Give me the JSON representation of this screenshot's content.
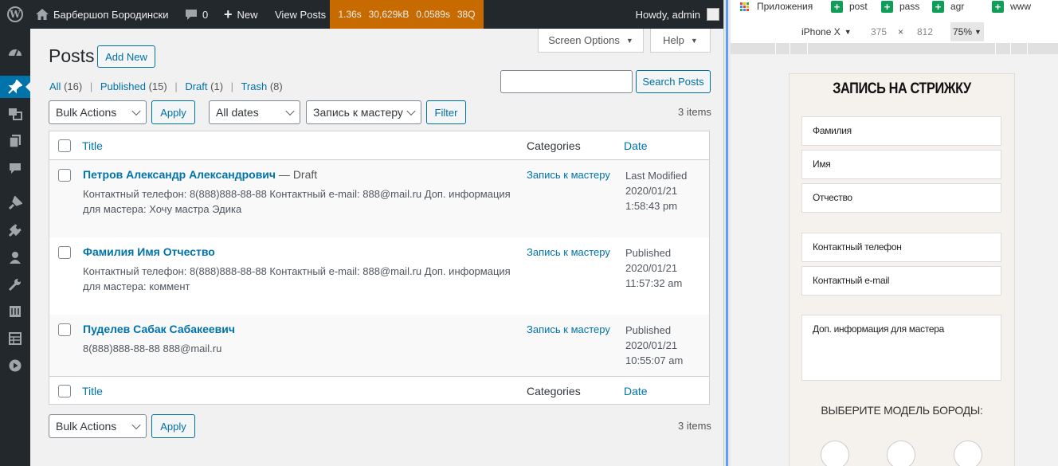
{
  "adminbar": {
    "wp_logo": "W",
    "site_name": "Барбершоп Бородински",
    "comments_count": "0",
    "new_label": "New",
    "view_posts_label": "View Posts",
    "qm": {
      "time": "1.36s",
      "memory": "30,629kB",
      "db_time": "0.0589s",
      "queries": "38Q"
    },
    "howdy": "Howdy, admin"
  },
  "sidebar": {
    "icons": [
      "dashboard-icon",
      "posts-icon",
      "media-icon",
      "pages-icon",
      "comments-icon",
      "appearance-icon",
      "plugins-icon",
      "users-icon",
      "tools-icon",
      "settings-icon",
      "table-icon",
      "play-icon"
    ],
    "active": "posts-icon"
  },
  "screen_options": {
    "screen_options_label": "Screen Options",
    "help_label": "Help"
  },
  "posts": {
    "title": "Posts",
    "add_new_label": "Add New",
    "views": [
      {
        "label": "All",
        "count": "(16)"
      },
      {
        "label": "Published",
        "count": "(15)"
      },
      {
        "label": "Draft",
        "count": "(1)"
      },
      {
        "label": "Trash",
        "count": "(8)"
      }
    ],
    "search_button": "Search Posts",
    "search_value": "",
    "bulk_actions": "Bulk Actions",
    "apply_label": "Apply",
    "dates_filter": "All dates",
    "category_filter": "Запись к мастеру",
    "filter_label": "Filter",
    "items_count": "3 items",
    "columns": {
      "title": "Title",
      "categories": "Categories",
      "date": "Date"
    },
    "rows": [
      {
        "title": "Петров Александр Александрович",
        "state": " — Draft",
        "excerpt": "Контактный телефон: 8(888)888-88-88 Контактный e-mail: 888@mail.ru Доп. информация для мастера: Хочу мастра Эдика",
        "category": "Запись к мастеру",
        "date_status": "Last Modified",
        "date": "2020/01/21",
        "time": "1:58:43 pm"
      },
      {
        "title": "Фамилия Имя Отчество",
        "state": "",
        "excerpt": "Контактный телефон: 8(888)888-88-88 Контактный e-mail: 888@mail.ru Доп. информация для мастера: коммент",
        "category": "Запись к мастеру",
        "date_status": "Published",
        "date": "2020/01/21",
        "time": "11:57:32 am"
      },
      {
        "title": "Пуделев Сабак Сабакеевич",
        "state": "",
        "excerpt": "8(888)888-88-88 888@mail.ru",
        "category": "Запись к мастеру",
        "date_status": "Published",
        "date": "2020/01/21",
        "time": "10:55:07 am"
      }
    ]
  },
  "bookmarks": [
    {
      "label": "Приложения",
      "icon": "apps-grid-icon"
    },
    {
      "label": "post",
      "icon": "sheets-icon"
    },
    {
      "label": "pass",
      "icon": "sheets-icon"
    },
    {
      "label": "agr",
      "icon": "sheets-icon"
    },
    {
      "label": "www",
      "icon": "sheets-icon"
    }
  ],
  "device": {
    "name": "iPhone X",
    "width": "375",
    "times": "×",
    "height": "812",
    "zoom": "75%"
  },
  "form": {
    "title": "ЗАПИСЬ НА СТРИЖКУ",
    "fields": [
      "Фамилия",
      "Имя",
      "Отчество",
      "Контактный телефон",
      "Контактный e-mail",
      "Доп. информация для мастера"
    ],
    "beard_title": "ВЫБЕРИТЕ МОДЕЛЬ БОРОДЫ:"
  },
  "colors": {
    "wp_blue": "#0073aa",
    "adminbar": "#23282d",
    "qm_orange": "#c76a00"
  }
}
